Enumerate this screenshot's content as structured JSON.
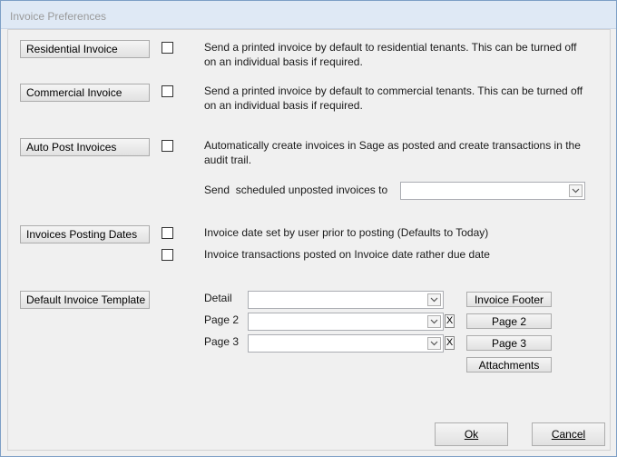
{
  "window": {
    "title": "Invoice Preferences"
  },
  "sections": {
    "residential": {
      "button_label": "Residential Invoice",
      "description_line1": "Send a printed invoice by default to residential tenants. This can be turned off",
      "description_line2": "on an individual basis if required.",
      "checked": false
    },
    "commercial": {
      "button_label": "Commercial Invoice",
      "description_line1": "Send a printed invoice by default to commercial tenants. This can be turned off",
      "description_line2": "on an individual basis if required.",
      "checked": false
    },
    "autopost": {
      "button_label": "Auto Post Invoices",
      "description_line1": "Automatically create invoices in Sage as posted and create transactions in the",
      "description_line2": "audit trail.",
      "checked": false,
      "send_label": "Send  scheduled unposted invoices to",
      "send_value": ""
    },
    "posting_dates": {
      "button_label": "Invoices Posting Dates",
      "option1_label": "Invoice date set by user prior to posting (Defaults to Today)",
      "option1_checked": false,
      "option2_label": "Invoice transactions posted on Invoice date rather due date",
      "option2_checked": false
    },
    "template": {
      "button_label": "Default Invoice Template",
      "detail_label": "Detail",
      "detail_value": "",
      "page2_label": "Page 2",
      "page2_value": "",
      "page3_label": "Page 3",
      "page3_value": "",
      "clear_label": "X",
      "invoice_footer_button": "Invoice Footer",
      "page2_button": "Page 2",
      "page3_button": "Page 3",
      "attachments_button": "Attachments"
    }
  },
  "footer": {
    "ok_label": "Ok",
    "cancel_label": "Cancel"
  },
  "icons": {
    "dropdown": "chevron-down-icon",
    "clear": "close-icon"
  }
}
